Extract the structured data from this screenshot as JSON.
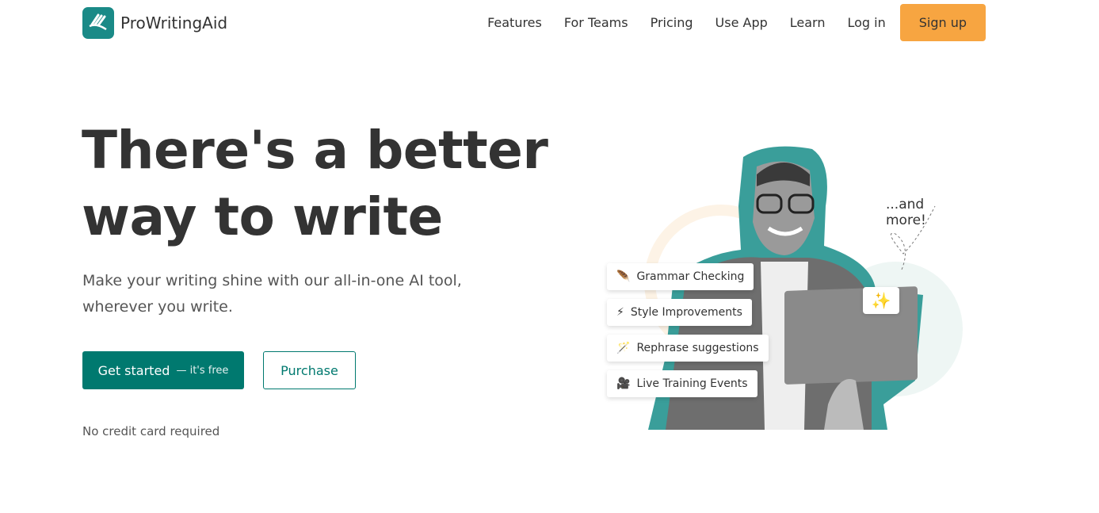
{
  "brand": {
    "name": "ProWritingAid",
    "color": "#1a8a87"
  },
  "nav": {
    "items": [
      "Features",
      "For Teams",
      "Pricing",
      "Use App",
      "Learn",
      "Log in"
    ],
    "signup": "Sign up"
  },
  "hero": {
    "title_line1": "There's a better",
    "title_line2": "way to write",
    "subtitle": "Make your writing shine with our all-in-one AI tool, wherever you write.",
    "cta_primary": "Get started",
    "cta_primary_suffix": "— it's free",
    "cta_secondary": "Purchase",
    "note": "No credit card required"
  },
  "illustration": {
    "features": [
      {
        "icon": "feather-icon",
        "glyph": "🪶",
        "label": "Grammar Checking"
      },
      {
        "icon": "lightning-icon",
        "glyph": "⚡",
        "label": "Style Improvements"
      },
      {
        "icon": "magic-wand-icon",
        "glyph": "🪄",
        "label": "Rephrase suggestions"
      },
      {
        "icon": "video-camera-icon",
        "glyph": "🎥",
        "label": "Live Training Events"
      }
    ],
    "more": "...and more!",
    "sparkle": "✨"
  },
  "colors": {
    "accent": "#00796f",
    "signup": "#f7a541",
    "blob": "#3a9e9a"
  }
}
